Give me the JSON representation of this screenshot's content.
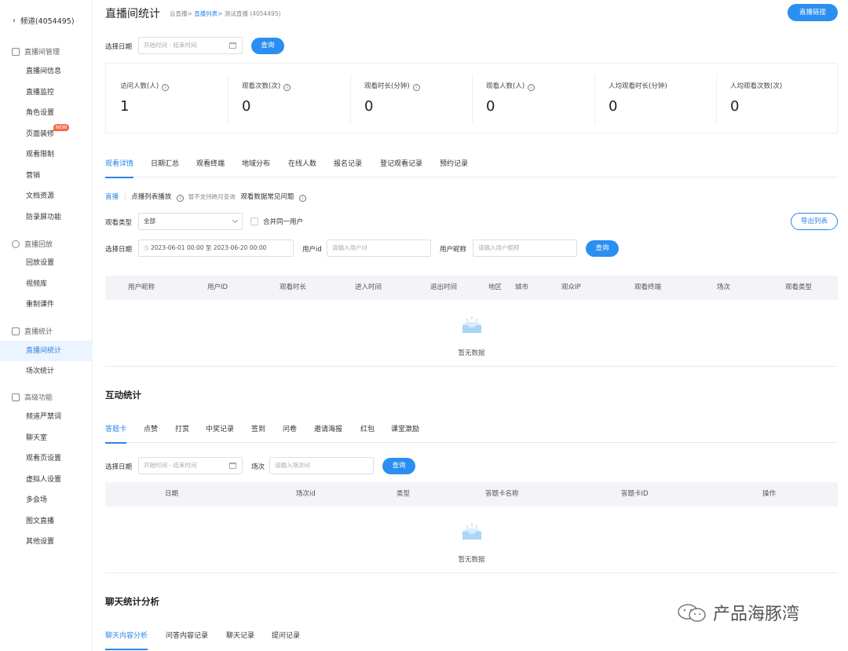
{
  "sidebar": {
    "back_label": "频道(4054495)",
    "groups": [
      {
        "label": "直播间管理",
        "items": [
          "直播间信息",
          "直播监控",
          "角色设置",
          "页面装修",
          "观看限制",
          "营销",
          "文档资源",
          "防录屏功能"
        ]
      },
      {
        "label": "直播回放",
        "items": [
          "回放设置",
          "视频库",
          "重制课件"
        ]
      },
      {
        "label": "直播统计",
        "items": [
          "直播间统计",
          "场次统计"
        ]
      },
      {
        "label": "高级功能",
        "items": [
          "频道严禁词",
          "聊天室",
          "观看页设置",
          "虚拟人设置",
          "多会场",
          "图文直播",
          "其他设置"
        ]
      }
    ],
    "new_badge": "NEW"
  },
  "header": {
    "title": "直播间统计",
    "breadcrumb": {
      "c1": "云直播>",
      "c2": "直播列表>",
      "c3": "测试直播 (4054495)"
    },
    "live_link_button": "直播链接"
  },
  "top_filter": {
    "date_label": "选择日期",
    "date_placeholder": "开始时间 - 结束时间",
    "query_button": "查询"
  },
  "stats": [
    {
      "label": "访问人数(人)",
      "value": "1"
    },
    {
      "label": "观看次数(次)",
      "value": "0"
    },
    {
      "label": "观看时长(分钟)",
      "value": "0"
    },
    {
      "label": "观看人数(人)",
      "value": "0"
    },
    {
      "label": "人均观看时长(分钟)",
      "value": "0"
    },
    {
      "label": "人均观看次数(次)",
      "value": "0"
    }
  ],
  "watch_tabs": [
    "观看详情",
    "日期汇总",
    "观看终端",
    "地域分布",
    "在线人数",
    "报名记录",
    "登记观看记录",
    "预约记录"
  ],
  "sub_nav": {
    "live": "直播",
    "sep": "|",
    "replay": "点播列表播放",
    "note": "暂不支持跨月查询",
    "faq": "观看数据常见问题"
  },
  "watch_filter": {
    "type_label": "观看类型",
    "type_value": "全部",
    "merge_label": "合并同一用户",
    "export_button": "导出列表",
    "date_label": "选择日期",
    "date_value": "2023-06-01 00:00  至  2023-06-20 00:00",
    "userid_label": "用户id",
    "userid_placeholder": "请输入用户id",
    "nick_label": "用户昵称",
    "nick_placeholder": "请输入用户昵称",
    "query_button": "查询"
  },
  "watch_table": {
    "columns": [
      "用户昵称",
      "用户ID",
      "观看时长",
      "进入时间",
      "退出时间",
      "地区",
      "城市",
      "观众IP",
      "观看终端",
      "场次",
      "观看类型"
    ],
    "empty_text": "暂无数据"
  },
  "interaction": {
    "title": "互动统计",
    "tabs": [
      "答题卡",
      "点赞",
      "打赏",
      "中奖记录",
      "签到",
      "问卷",
      "邀请海报",
      "红包",
      "课堂激励"
    ],
    "date_label": "选择日期",
    "date_placeholder": "开始时间 - 结束时间",
    "session_label": "场次",
    "session_placeholder": "请输入场次id",
    "query_button": "查询",
    "columns": [
      "日期",
      "场次id",
      "类型",
      "答题卡名称",
      "答题卡ID",
      "操作"
    ],
    "empty_text": "暂无数据"
  },
  "chat": {
    "title": "聊天统计分析",
    "tabs": [
      "聊天内容分析",
      "问答内容记录",
      "聊天记录",
      "提问记录"
    ]
  },
  "watermark": "产品海豚湾",
  "colors": {
    "accent": "#2a86e8",
    "primary_button": "#2a8ff0",
    "active_bg": "#ebf4ff",
    "badge": "#f36b4b"
  }
}
